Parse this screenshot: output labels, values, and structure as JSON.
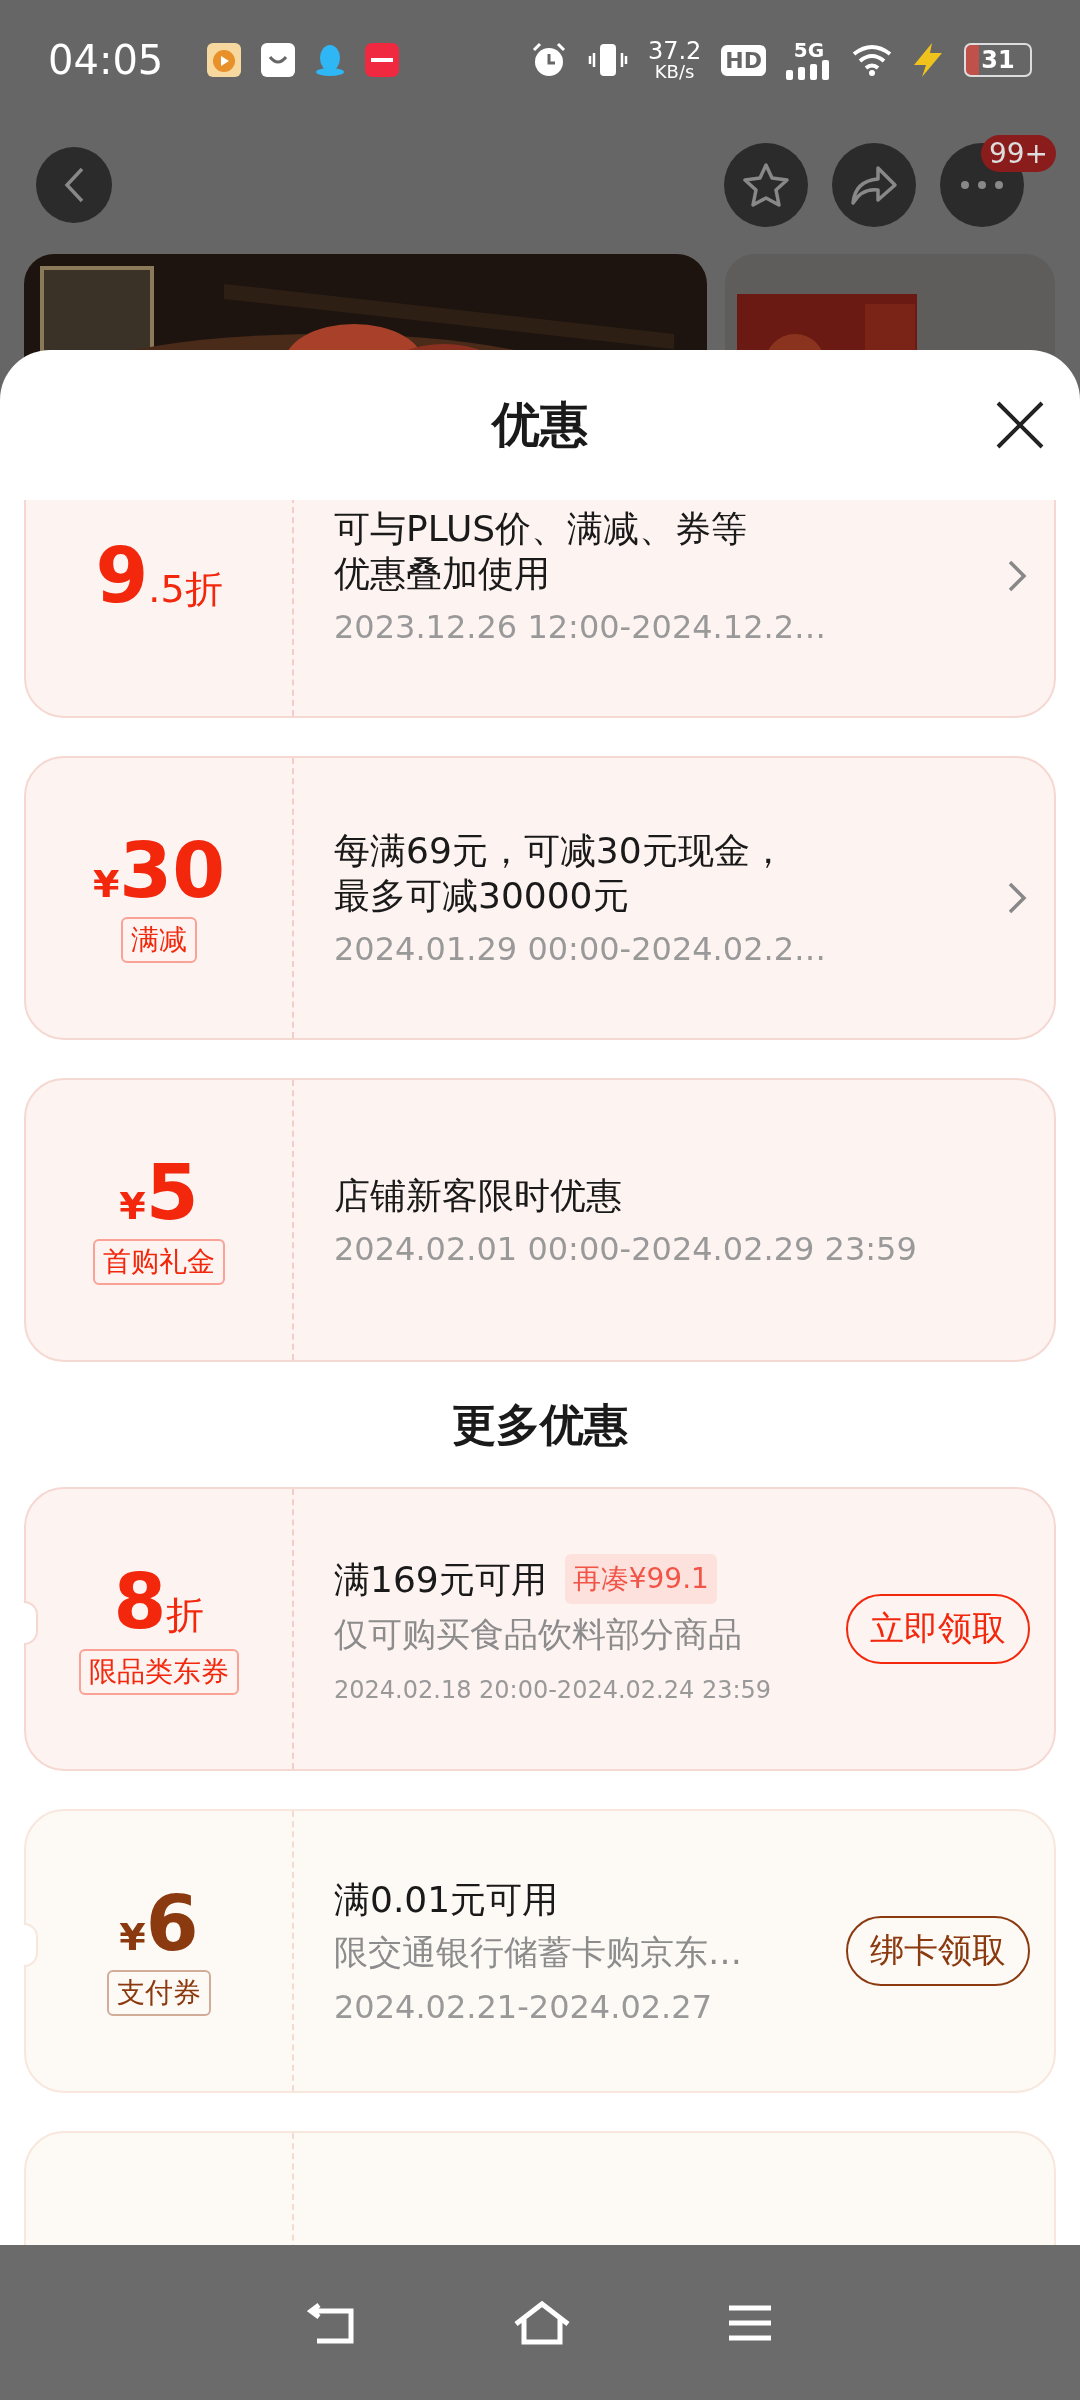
{
  "status_bar": {
    "time": "04:05",
    "speed": "37.2",
    "speed_unit": "KB/s",
    "hd": "HD",
    "network": "5G",
    "battery": "31"
  },
  "top_bar": {
    "badge": "99+"
  },
  "sheet": {
    "title": "优惠"
  },
  "coupons": [
    {
      "kind": "full",
      "color": "#f2270c",
      "main": "9",
      "suffix": ".5折",
      "title": [
        "可与PLUS价、满减、券等",
        "优惠叠加使用"
      ],
      "date": "2023.12.26 12:00-2024.12.2…",
      "chevron": true
    },
    {
      "kind": "full",
      "color": "#f2270c",
      "prefix": "¥",
      "main": "30",
      "tag": "满减",
      "title": [
        "每满69元，可减30元现金，",
        "最多可减30000元"
      ],
      "date": "2024.01.29 00:00-2024.02.2…",
      "chevron": true
    },
    {
      "kind": "full",
      "color": "#f2270c",
      "prefix": "¥",
      "main": "5",
      "tag": "首购礼金",
      "title": "店铺新客限时优惠",
      "date": "2024.02.01 00:00-2024.02.29 23:59",
      "chevron": false
    }
  ],
  "more": {
    "title": "更多优惠",
    "coupons": [
      {
        "kind": "full",
        "color": "#f2270c",
        "main": "8",
        "suffix": "折",
        "tag": "限品类东券",
        "title": "满169元可用",
        "chip": "再凑¥99.1",
        "desc": "仅可购买食品饮料部分商品",
        "date": "2024.02.18 20:00-2024.02.24 23:59",
        "small_date": true,
        "button": "立即领取"
      },
      {
        "kind": "full",
        "color": "#8b3a0f",
        "prefix": "¥",
        "main": "6",
        "tag": "支付券",
        "title": "满0.01元可用",
        "desc": "限交通银行储蓄卡购京东…",
        "date": "2024.02.21-2024.02.27",
        "small_date": false,
        "button": "绑卡领取"
      },
      {
        "kind": "partial"
      }
    ]
  }
}
